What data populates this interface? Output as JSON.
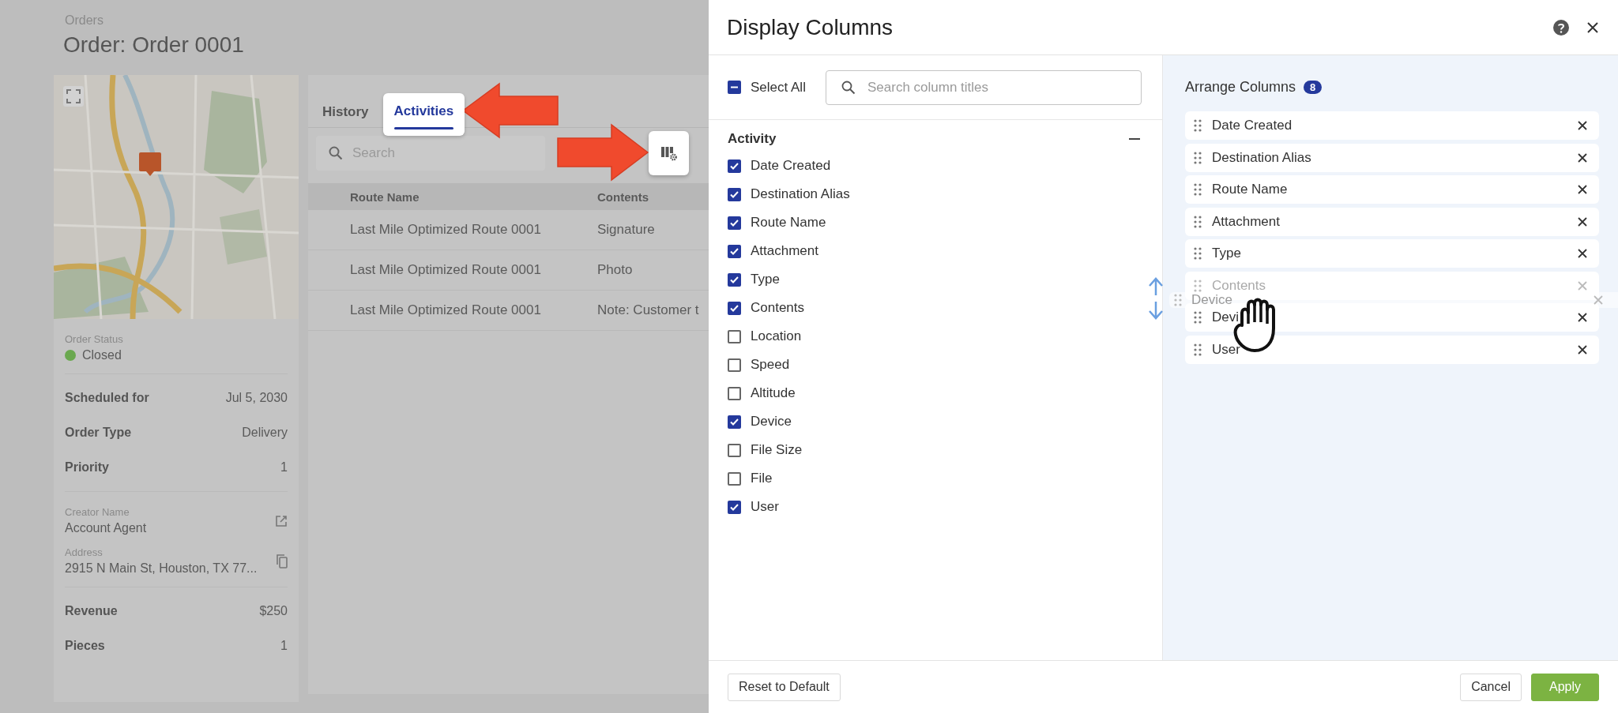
{
  "background": {
    "breadcrumb": "Orders",
    "title": "Order: Order 0001",
    "order_status": {
      "label": "Order Status",
      "value": "Closed",
      "color": "#6aa84f"
    },
    "details": [
      {
        "label": "Scheduled for",
        "value": "Jul 5, 2030"
      },
      {
        "label": "Order Type",
        "value": "Delivery"
      },
      {
        "label": "Priority",
        "value": "1"
      }
    ],
    "creator": {
      "label": "Creator Name",
      "value": "Account Agent"
    },
    "address": {
      "label": "Address",
      "value": "2915 N Main St, Houston, TX 77..."
    },
    "totals": [
      {
        "label": "Revenue",
        "value": "$250"
      },
      {
        "label": "Pieces",
        "value": "1"
      }
    ],
    "tabs": [
      {
        "label": "History",
        "selected": false
      },
      {
        "label": "Activities",
        "selected": true
      }
    ],
    "search": {
      "placeholder": "Search"
    },
    "table": {
      "columns": [
        "Route Name",
        "Contents"
      ],
      "rows": [
        [
          "Last Mile Optimized Route 0001",
          "Signature"
        ],
        [
          "Last Mile Optimized Route 0001",
          "Photo"
        ],
        [
          "Last Mile Optimized Route 0001",
          "Note: Customer t"
        ]
      ]
    }
  },
  "dialog": {
    "title": "Display Columns",
    "select_all": {
      "label": "Select All",
      "indeterminate": true
    },
    "search": {
      "placeholder": "Search column titles"
    },
    "group": {
      "title": "Activity",
      "expanded": true,
      "items": [
        {
          "label": "Date Created",
          "checked": true
        },
        {
          "label": "Destination Alias",
          "checked": true
        },
        {
          "label": "Route Name",
          "checked": true
        },
        {
          "label": "Attachment",
          "checked": true
        },
        {
          "label": "Type",
          "checked": true
        },
        {
          "label": "Contents",
          "checked": true
        },
        {
          "label": "Location",
          "checked": false
        },
        {
          "label": "Speed",
          "checked": false
        },
        {
          "label": "Altitude",
          "checked": false
        },
        {
          "label": "Device",
          "checked": true
        },
        {
          "label": "File Size",
          "checked": false
        },
        {
          "label": "File",
          "checked": false
        },
        {
          "label": "User",
          "checked": true
        }
      ]
    },
    "arrange": {
      "title": "Arrange Columns",
      "count": "8",
      "items": [
        {
          "label": "Date Created",
          "dimmed": false
        },
        {
          "label": "Destination Alias",
          "dimmed": false
        },
        {
          "label": "Route Name",
          "dimmed": false
        },
        {
          "label": "Attachment",
          "dimmed": false
        },
        {
          "label": "Type",
          "dimmed": false
        },
        {
          "label": "Contents",
          "dimmed": true
        },
        {
          "label": "Devi",
          "dimmed": false
        },
        {
          "label": "User",
          "dimmed": false
        }
      ]
    },
    "dragging": {
      "label": "Device"
    },
    "buttons": {
      "reset": "Reset to Default",
      "cancel": "Cancel",
      "apply": "Apply"
    }
  }
}
